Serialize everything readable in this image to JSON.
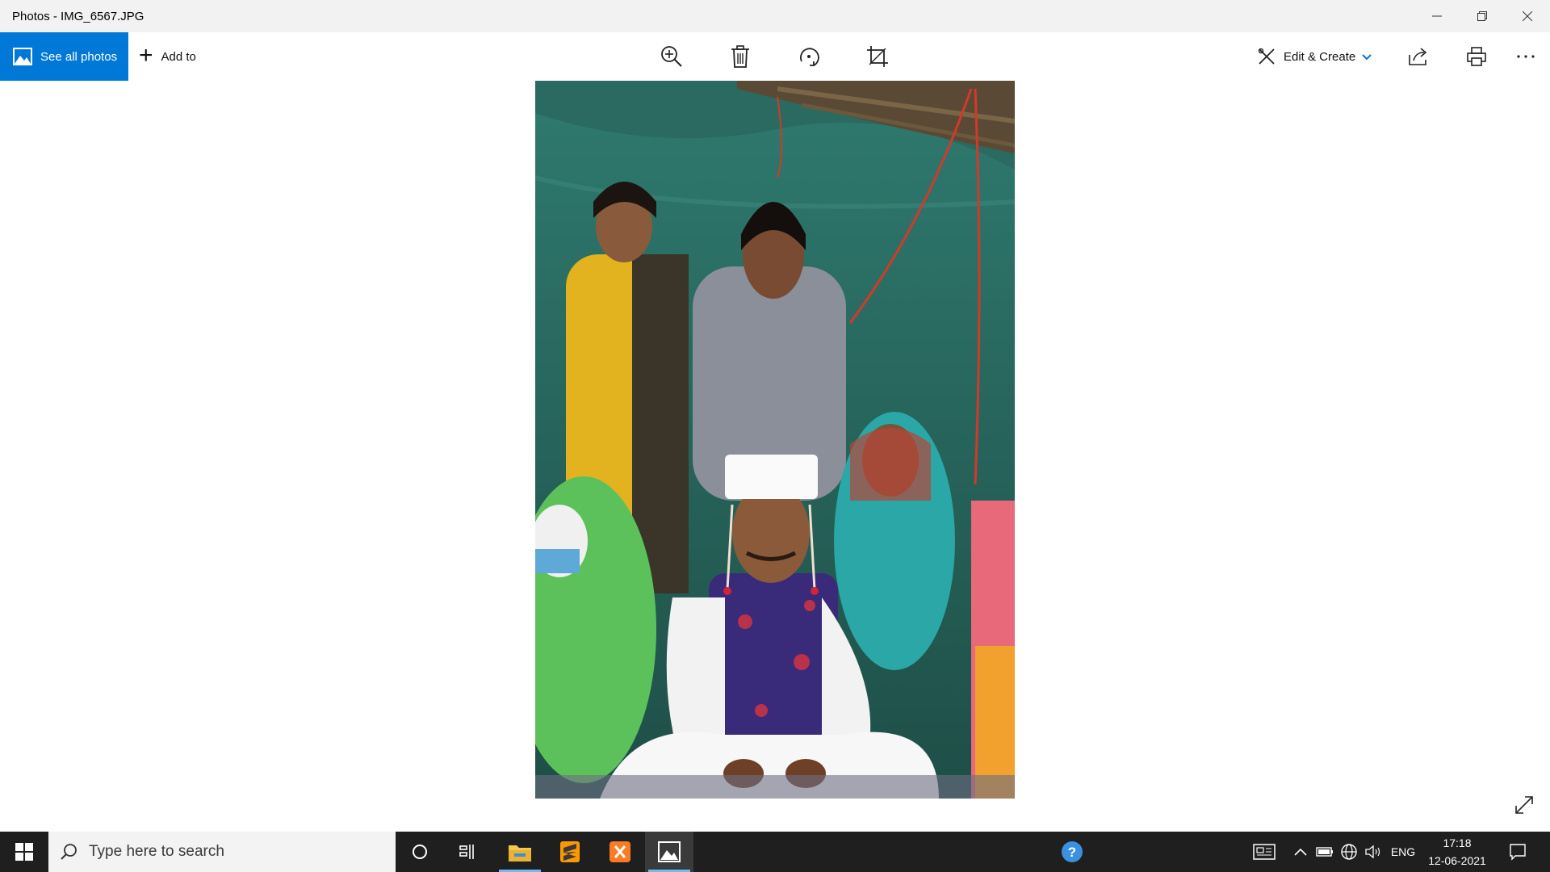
{
  "window": {
    "title": "Photos - IMG_6567.JPG"
  },
  "toolbar": {
    "see_all_photos": "See all photos",
    "add_to": "Add to",
    "edit_create": "Edit & Create"
  },
  "colors": {
    "accent": "#0078d7",
    "taskbar": "#1f1f1f",
    "titlebar": "#f2f2f2"
  },
  "icons": [
    "zoom-in-icon",
    "delete-icon",
    "rotate-icon",
    "crop-icon",
    "edit-create-icon",
    "share-icon",
    "print-icon",
    "more-icon",
    "expand-icon"
  ],
  "taskbar": {
    "search_placeholder": "Type here to search",
    "language": "ENG",
    "time": "17:18",
    "date": "12-06-2021"
  }
}
